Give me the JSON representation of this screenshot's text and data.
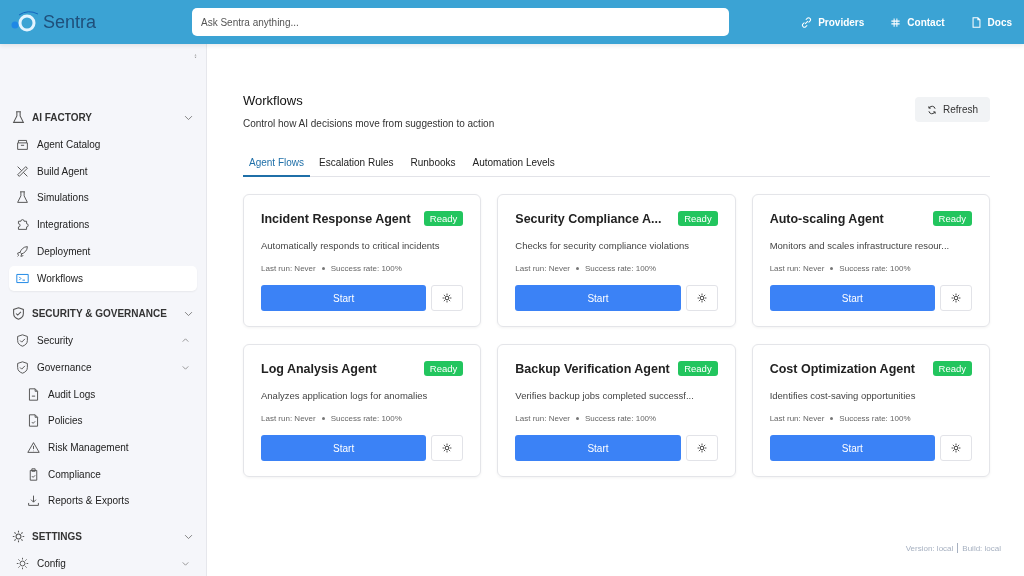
{
  "header": {
    "brand": "Sentra",
    "search": {
      "placeholder": "Ask Sentra anything..."
    },
    "links": [
      "Providers",
      "Contact",
      "Docs"
    ]
  },
  "sidebar": {
    "sections": [
      {
        "title": "AI FACTORY",
        "expanded": true,
        "items": [
          {
            "label": "Agent Catalog",
            "selected": false
          },
          {
            "label": "Build Agent",
            "selected": false
          },
          {
            "label": "Simulations",
            "selected": false
          },
          {
            "label": "Integrations",
            "selected": false
          },
          {
            "label": "Deployment",
            "selected": false
          },
          {
            "label": "Workflows",
            "selected": true
          }
        ]
      },
      {
        "title": "SECURITY & GOVERNANCE",
        "expanded": true,
        "items": [
          {
            "label": "Security",
            "selected": false,
            "expanded": false
          },
          {
            "label": "Governance",
            "selected": false,
            "expanded": true,
            "children": [
              {
                "label": "Audit Logs",
                "selected": false
              },
              {
                "label": "Policies",
                "selected": false
              },
              {
                "label": "Risk Management",
                "selected": false
              },
              {
                "label": "Compliance",
                "selected": false
              },
              {
                "label": "Reports & Exports",
                "selected": false
              }
            ]
          }
        ]
      },
      {
        "title": "SETTINGS",
        "expanded": true,
        "items": [
          {
            "label": "Config",
            "selected": false,
            "expanded": true
          }
        ]
      }
    ]
  },
  "page": {
    "title": "Workflows",
    "subtitle": "Control how AI decisions move from suggestion to action",
    "refresh": "Refresh",
    "tabs": [
      {
        "label": "Agent Flows",
        "selected": true
      },
      {
        "label": "Escalation Rules",
        "selected": false
      },
      {
        "label": "Runbooks",
        "selected": false
      },
      {
        "label": "Automation Levels",
        "selected": false
      }
    ],
    "agents": [
      {
        "name": "Incident Response Agent",
        "status": "Ready",
        "description": "Automatically responds to critical incidents",
        "last_run": "Last run: Never",
        "success": "Success rate: 100%",
        "action": "Start"
      },
      {
        "name": "Security Compliance A...",
        "status": "Ready",
        "description": "Checks for security compliance violations",
        "last_run": "Last run: Never",
        "success": "Success rate: 100%",
        "action": "Start"
      },
      {
        "name": "Auto-scaling Agent",
        "status": "Ready",
        "description": "Monitors and scales infrastructure resour...",
        "last_run": "Last run: Never",
        "success": "Success rate: 100%",
        "action": "Start"
      },
      {
        "name": "Log Analysis Agent",
        "status": "Ready",
        "description": "Analyzes application logs for anomalies",
        "last_run": "Last run: Never",
        "success": "Success rate: 100%",
        "action": "Start"
      },
      {
        "name": "Backup Verification Agent",
        "status": "Ready",
        "description": "Verifies backup jobs completed successf...",
        "last_run": "Last run: Never",
        "success": "Success rate: 100%",
        "action": "Start"
      },
      {
        "name": "Cost Optimization Agent",
        "status": "Ready",
        "description": "Identifies cost-saving opportunities",
        "last_run": "Last run: Never",
        "success": "Success rate: 100%",
        "action": "Start"
      }
    ]
  },
  "footer": {
    "version": "Version: local",
    "build": "Build: local"
  }
}
